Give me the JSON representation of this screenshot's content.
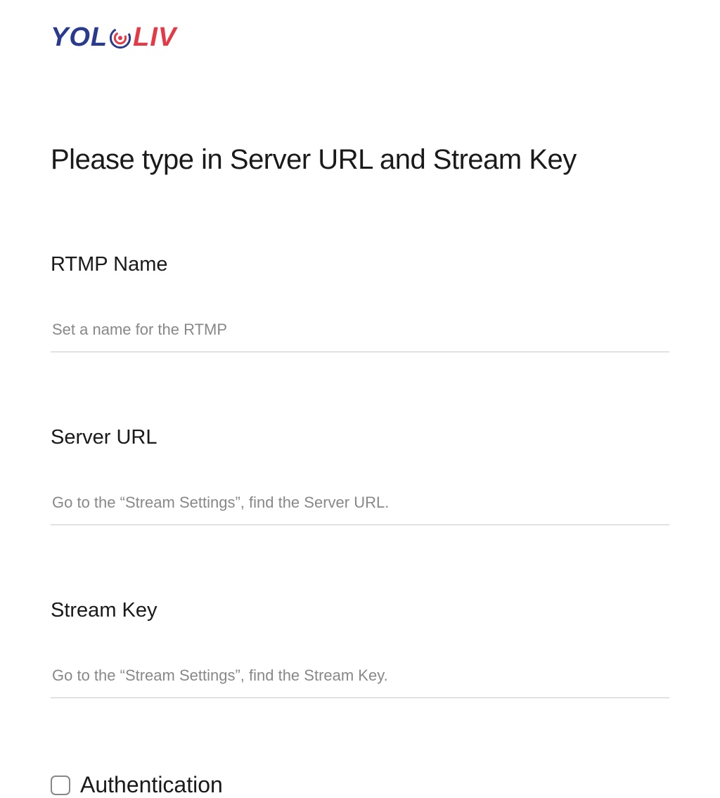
{
  "logo": {
    "part1": "YOL",
    "part2": "LIV"
  },
  "page_title": "Please type in Server URL and Stream Key",
  "form": {
    "rtmp_name": {
      "label": "RTMP Name",
      "placeholder": "Set a name for the RTMP",
      "value": ""
    },
    "server_url": {
      "label": "Server URL",
      "placeholder": "Go to the “Stream Settings”, find the Server URL.",
      "value": ""
    },
    "stream_key": {
      "label": "Stream Key",
      "placeholder": "Go to the “Stream Settings”, find the Stream Key.",
      "value": ""
    },
    "authentication": {
      "label": "Authentication",
      "checked": false
    }
  }
}
